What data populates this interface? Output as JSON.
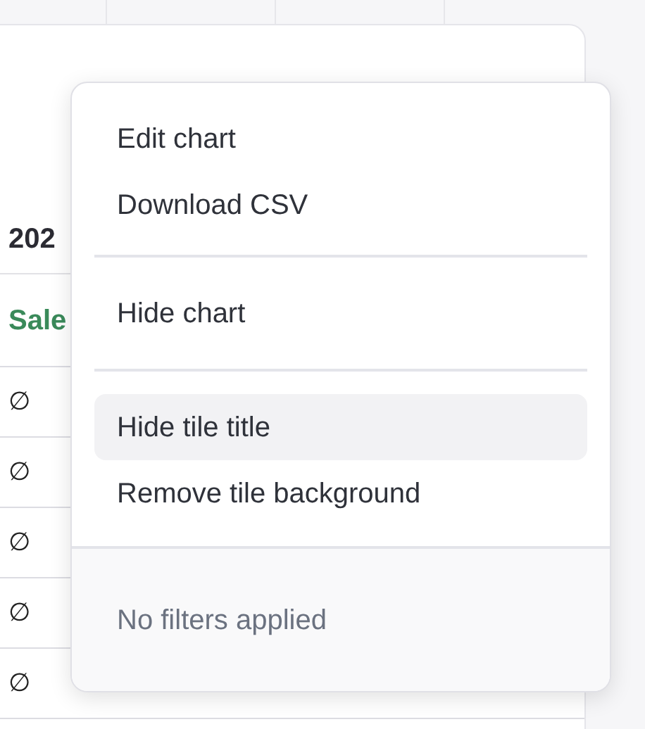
{
  "tile": {
    "title": "202",
    "column_header": "Sale",
    "rows": [
      "∅",
      "∅",
      "∅",
      "∅",
      "∅"
    ]
  },
  "menu": {
    "sections": [
      {
        "items": [
          {
            "label": "Edit chart",
            "selected": false
          },
          {
            "label": "Download CSV",
            "selected": false
          }
        ]
      },
      {
        "items": [
          {
            "label": "Hide chart",
            "selected": false
          }
        ]
      },
      {
        "items": [
          {
            "label": "Hide tile title",
            "selected": true
          },
          {
            "label": "Remove tile background",
            "selected": false
          }
        ]
      }
    ],
    "footer": "No filters applied"
  }
}
